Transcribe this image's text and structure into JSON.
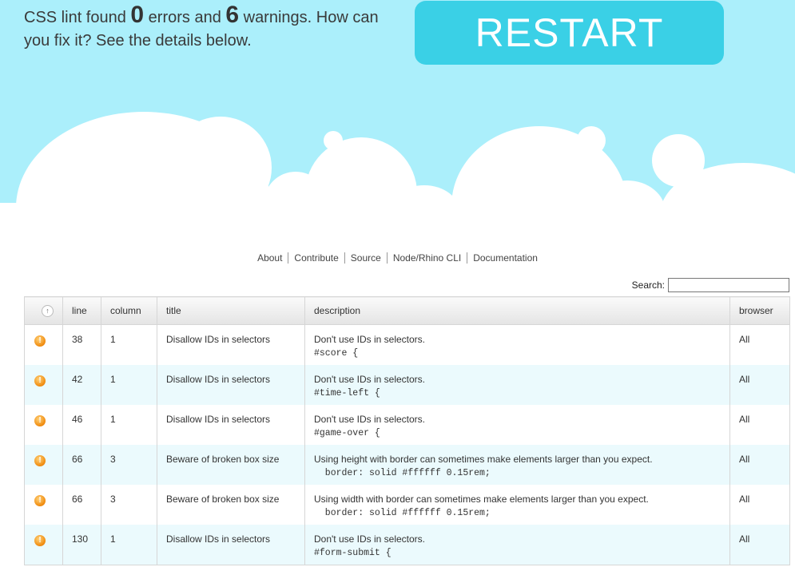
{
  "summary": {
    "text_1": "CSS lint found ",
    "errors": "0",
    "text_2": " errors and ",
    "warnings": "6",
    "text_3": " warnings. How can you fix it? See the details below."
  },
  "restart_label": "RESTART",
  "nav": [
    "About",
    "Contribute",
    "Source",
    "Node/Rhino CLI",
    "Documentation"
  ],
  "search": {
    "label": "Search:",
    "value": ""
  },
  "table": {
    "sort_icon": "↑",
    "headers": {
      "line": "line",
      "column": "column",
      "title": "title",
      "description": "description",
      "browser": "browser"
    },
    "rows": [
      {
        "icon": "warning-icon",
        "line": "38",
        "column": "1",
        "title": "Disallow IDs in selectors",
        "desc": "Don't use IDs in selectors.",
        "code": "#score {",
        "browser": "All"
      },
      {
        "icon": "warning-icon",
        "line": "42",
        "column": "1",
        "title": "Disallow IDs in selectors",
        "desc": "Don't use IDs in selectors.",
        "code": "#time-left {",
        "browser": "All"
      },
      {
        "icon": "warning-icon",
        "line": "46",
        "column": "1",
        "title": "Disallow IDs in selectors",
        "desc": "Don't use IDs in selectors.",
        "code": "#game-over {",
        "browser": "All"
      },
      {
        "icon": "warning-icon",
        "line": "66",
        "column": "3",
        "title": "Beware of broken box size",
        "desc": "Using height with border can sometimes make elements larger than you expect.",
        "code": "  border: solid #ffffff 0.15rem;",
        "browser": "All"
      },
      {
        "icon": "warning-icon",
        "line": "66",
        "column": "3",
        "title": "Beware of broken box size",
        "desc": "Using width with border can sometimes make elements larger than you expect.",
        "code": "  border: solid #ffffff 0.15rem;",
        "browser": "All"
      },
      {
        "icon": "warning-icon",
        "line": "130",
        "column": "1",
        "title": "Disallow IDs in selectors",
        "desc": "Don't use IDs in selectors.",
        "code": "#form-submit {",
        "browser": "All"
      }
    ]
  },
  "colors": {
    "sky": "#abeffb",
    "button": "#3ad0e6",
    "row_alt": "#ebfafd"
  }
}
